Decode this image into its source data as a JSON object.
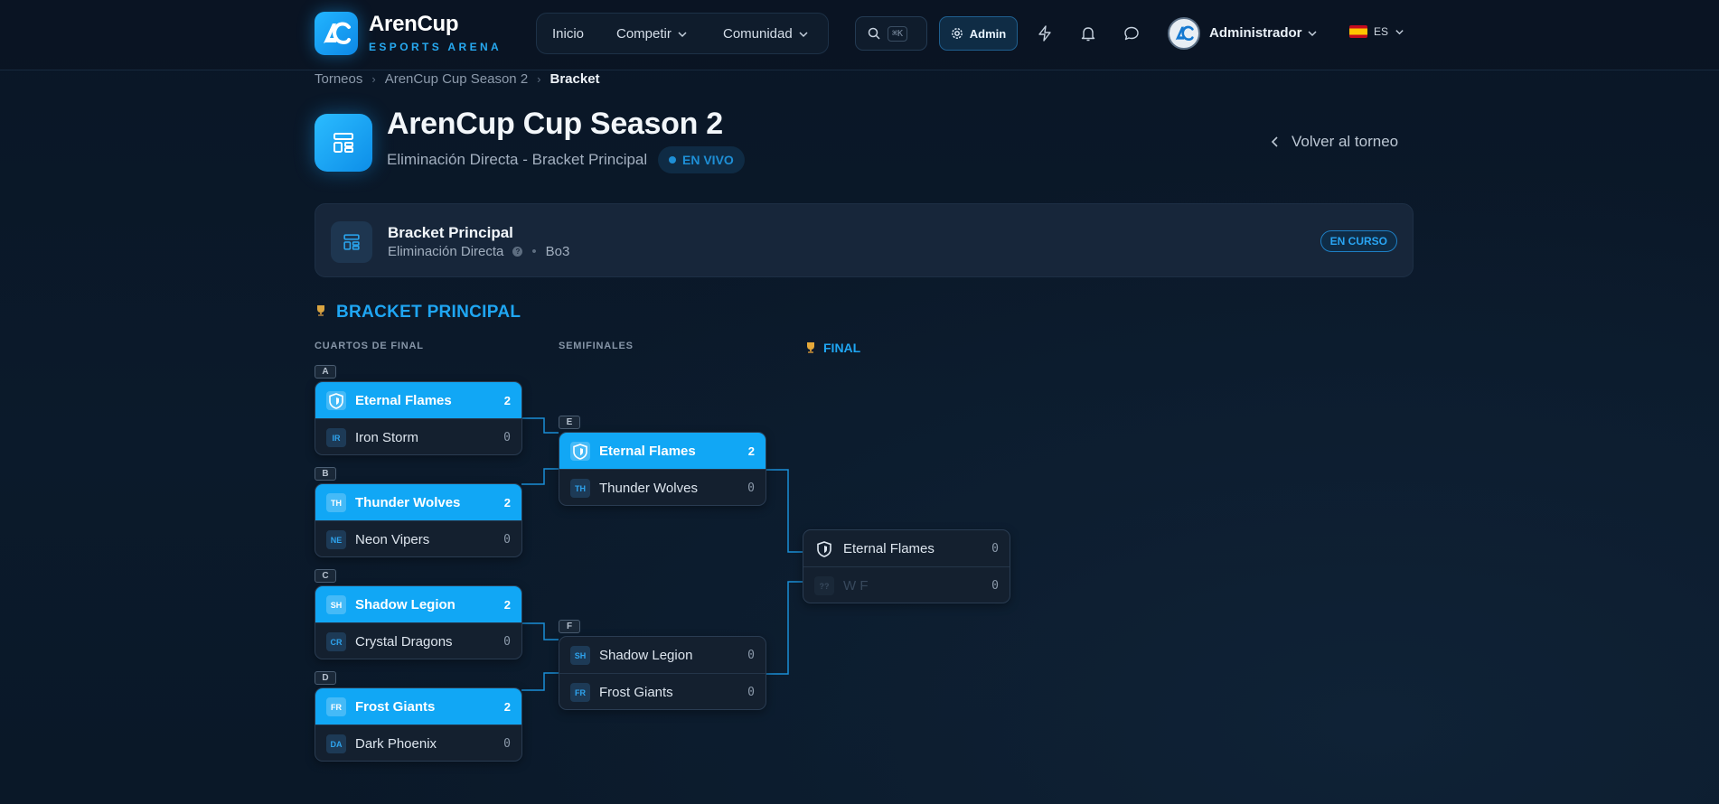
{
  "brand": {
    "name": "ArenCup",
    "tagline": "ESPORTS ARENA",
    "logo_icon": "arencup-logo-icon"
  },
  "nav": {
    "items": [
      {
        "label": "Inicio",
        "dropdown": false
      },
      {
        "label": "Competir",
        "dropdown": true
      },
      {
        "label": "Comunidad",
        "dropdown": true
      }
    ],
    "search_shortcut": "⌘K",
    "admin_label": "Admin",
    "icons": [
      "search-icon",
      "gear-icon",
      "lightning-icon",
      "bell-icon",
      "chat-icon"
    ],
    "user_name": "Administrador",
    "language": "ES"
  },
  "breadcrumb": {
    "items": [
      "Torneos",
      "ArenCup Cup Season 2",
      "Bracket"
    ]
  },
  "header": {
    "title": "ArenCup Cup Season 2",
    "subtitle": "Eliminación Directa - Bracket Principal",
    "live_badge": "EN VIVO",
    "back_link": "Volver al torneo"
  },
  "bracket_card": {
    "title": "Bracket Principal",
    "format": "Eliminación Directa",
    "series": "Bo3",
    "status": "EN CURSO"
  },
  "section_title": "BRACKET PRINCIPAL",
  "rounds": {
    "quarterfinals": "CUARTOS DE FINAL",
    "semifinals": "SEMIFINALES",
    "final": "FINAL"
  },
  "matches": {
    "A": {
      "label": "A",
      "team1": {
        "name": "Eternal Flames",
        "abbr": "",
        "score": "2",
        "winner": true
      },
      "team2": {
        "name": "Iron Storm",
        "abbr": "IR",
        "score": "0",
        "winner": false
      }
    },
    "B": {
      "label": "B",
      "team1": {
        "name": "Thunder Wolves",
        "abbr": "TH",
        "score": "2",
        "winner": true
      },
      "team2": {
        "name": "Neon Vipers",
        "abbr": "NE",
        "score": "0",
        "winner": false
      }
    },
    "C": {
      "label": "C",
      "team1": {
        "name": "Shadow Legion",
        "abbr": "SH",
        "score": "2",
        "winner": true
      },
      "team2": {
        "name": "Crystal Dragons",
        "abbr": "CR",
        "score": "0",
        "winner": false
      }
    },
    "D": {
      "label": "D",
      "team1": {
        "name": "Frost Giants",
        "abbr": "FR",
        "score": "2",
        "winner": true
      },
      "team2": {
        "name": "Dark Phoenix",
        "abbr": "DA",
        "score": "0",
        "winner": false
      }
    },
    "E": {
      "label": "E",
      "team1": {
        "name": "Eternal Flames",
        "abbr": "",
        "score": "2",
        "winner": true
      },
      "team2": {
        "name": "Thunder Wolves",
        "abbr": "TH",
        "score": "0",
        "winner": false
      }
    },
    "F": {
      "label": "F",
      "team1": {
        "name": "Shadow Legion",
        "abbr": "SH",
        "score": "0",
        "winner": false
      },
      "team2": {
        "name": "Frost Giants",
        "abbr": "FR",
        "score": "0",
        "winner": false
      }
    },
    "FINAL": {
      "team1": {
        "name": "Eternal Flames",
        "abbr": "",
        "score": "0",
        "winner": false
      },
      "team2": {
        "name": "W F",
        "abbr": "??",
        "score": "0",
        "winner": false,
        "tbd": true
      }
    }
  },
  "colors": {
    "accent": "#11a7f5",
    "background": "#0b1a2b",
    "card": "#17263a"
  }
}
